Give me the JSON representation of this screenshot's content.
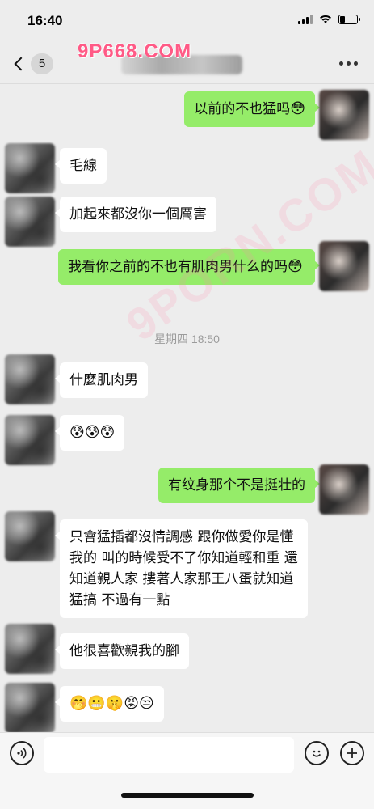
{
  "status_bar": {
    "time": "16:40"
  },
  "nav": {
    "back_count": "5",
    "watermark": "9P668.COM"
  },
  "messages": [
    {
      "side": "out",
      "text": "以前的不也猛吗",
      "emoji": "😳"
    },
    {
      "side": "in",
      "text": "毛線"
    },
    {
      "side": "in",
      "text": "加起來都沒你一個厲害"
    },
    {
      "side": "out",
      "text": "我看你之前的不也有肌肉男什么的吗",
      "emoji": "😳"
    },
    {
      "side": "in",
      "text": "什麼肌肉男"
    },
    {
      "side": "in",
      "text": "",
      "emoji": "😰😰😰"
    },
    {
      "side": "out",
      "text": "有纹身那个不是挺壮的"
    },
    {
      "side": "in",
      "text": "只會猛插都沒情調感 跟你做愛你是懂我的 叫的時候受不了你知道輕和重 還知道親人家 摟著人家那王八蛋就知道猛搞 不過有一點"
    },
    {
      "side": "in",
      "text": "他很喜歡親我的腳"
    },
    {
      "side": "in",
      "text": "",
      "emoji": "🤭😬🤫😡😒"
    }
  ],
  "timestamp": "星期四 18:50",
  "diagonal_watermark": "9PORN.COM",
  "colors": {
    "outgoing_bubble": "#95ec69",
    "incoming_bubble": "#ffffff",
    "background": "#ededed"
  },
  "icons": {
    "back": "chevron-left-icon",
    "more": "more-dots-icon",
    "voice": "voice-icon",
    "emoji": "emoji-icon",
    "plus": "plus-icon"
  }
}
